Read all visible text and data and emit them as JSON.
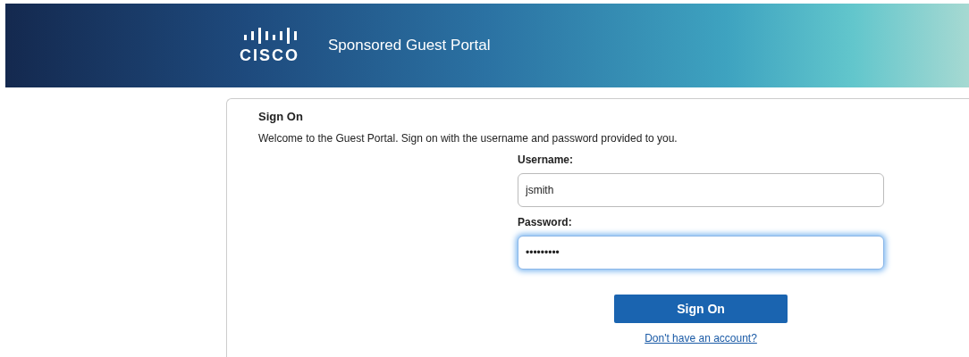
{
  "header": {
    "logo_text": "CISCO",
    "title": "Sponsored Guest Portal"
  },
  "sign_on": {
    "heading": "Sign On",
    "intro": "Welcome to the Guest Portal. Sign on with the username and password provided to you.",
    "fields": [
      {
        "label": "Username:",
        "value": "jsmith",
        "focused": false
      },
      {
        "label": "Password:",
        "value": "•••••••••",
        "focused": true
      }
    ],
    "button": "Sign On",
    "link": "Don't have an account?"
  }
}
